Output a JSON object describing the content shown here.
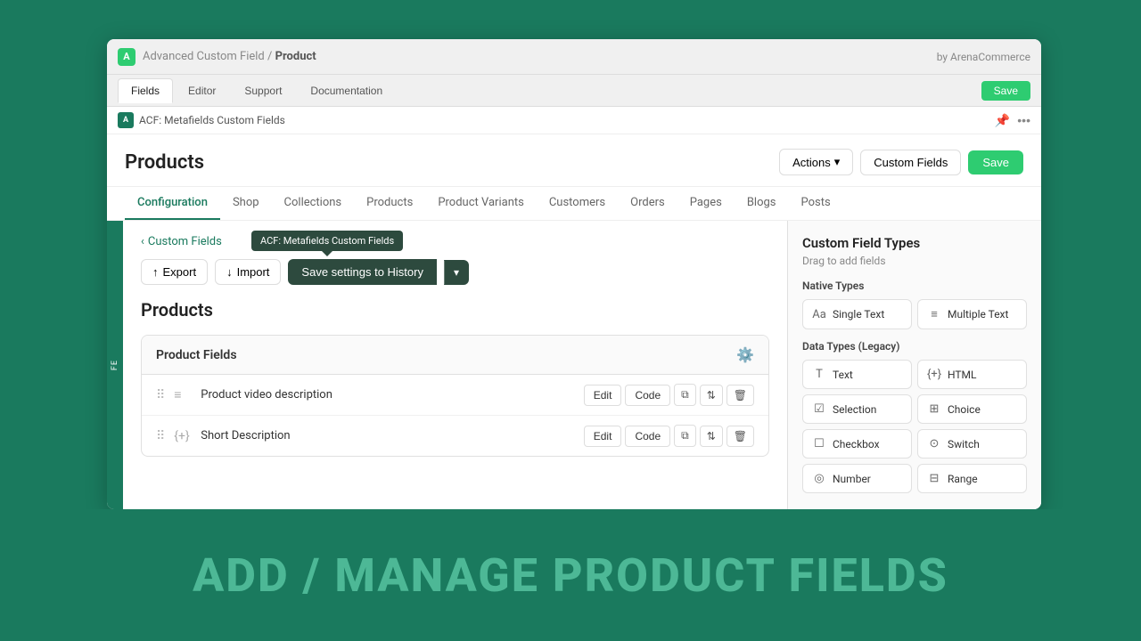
{
  "bottom_banner": {
    "text": "ADD / MANAGE PRODUCT FIELDS"
  },
  "browser": {
    "top_bar": {
      "logo_text": "A",
      "breadcrumb_prefix": "Advanced Custom Field",
      "breadcrumb_separator": "/",
      "breadcrumb_page": "Product",
      "by_text": "by ArenaCommerce"
    },
    "tabs": {
      "items": [
        {
          "label": "Fields",
          "active": true
        },
        {
          "label": "Editor",
          "active": false
        },
        {
          "label": "Support",
          "active": false
        },
        {
          "label": "Documentation",
          "active": false
        }
      ],
      "save_label": "Save"
    },
    "sub_bar": {
      "icon_text": "A",
      "label": "ACF: Metafields Custom Fields",
      "pin_icon": "📌",
      "more_icon": "•••"
    },
    "page": {
      "title": "Products",
      "actions_btn": "Actions",
      "custom_fields_btn": "Custom Fields",
      "save_btn": "Save"
    },
    "nav_tabs": [
      {
        "label": "Configuration",
        "active": true
      },
      {
        "label": "Shop",
        "active": false
      },
      {
        "label": "Collections",
        "active": false
      },
      {
        "label": "Products",
        "active": false
      },
      {
        "label": "Product Variants",
        "active": false
      },
      {
        "label": "Customers",
        "active": false
      },
      {
        "label": "Orders",
        "active": false
      },
      {
        "label": "Pages",
        "active": false
      },
      {
        "label": "Blogs",
        "active": false
      },
      {
        "label": "Posts",
        "active": false
      }
    ],
    "toolbar": {
      "back_label": "Custom Fields",
      "export_label": "Export",
      "import_label": "Import",
      "save_history_label": "Save settings to History",
      "tooltip_text": "ACF: Metafields Custom Fields"
    },
    "section_title": "Products",
    "product_fields_card": {
      "title": "Product Fields",
      "fields": [
        {
          "name": "Product video description",
          "icon": "≡",
          "edit_label": "Edit",
          "code_label": "Code"
        },
        {
          "name": "Short Description",
          "icon": "{+}",
          "edit_label": "Edit",
          "code_label": "Code"
        }
      ]
    },
    "custom_field_types": {
      "panel_title": "Custom Field Types",
      "panel_subtitle": "Drag to add fields",
      "native_section": "Native Types",
      "legacy_section": "Data Types (Legacy)",
      "native_types": [
        {
          "icon": "Aa",
          "label": "Single Text"
        },
        {
          "icon": "≡≡",
          "label": "Multiple Text"
        }
      ],
      "legacy_types": [
        {
          "icon": "T",
          "label": "Text"
        },
        {
          "icon": "{+}",
          "label": "HTML"
        },
        {
          "icon": "☑",
          "label": "Selection"
        },
        {
          "icon": "⊞",
          "label": "Choice"
        },
        {
          "icon": "☐",
          "label": "Checkbox"
        },
        {
          "icon": "⊙",
          "label": "Switch"
        },
        {
          "icon": "◎",
          "label": "Number"
        },
        {
          "icon": "⊟",
          "label": "Range"
        }
      ]
    }
  }
}
